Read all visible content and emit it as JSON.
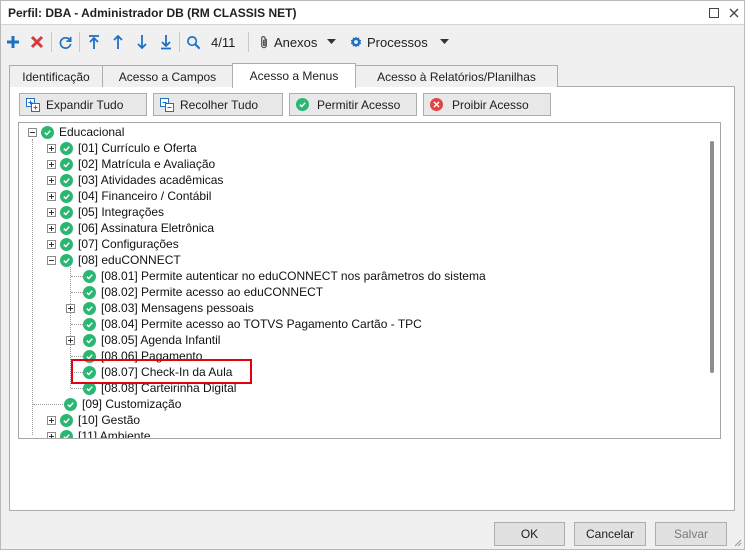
{
  "window": {
    "title": "Perfil: DBA - Administrador DB (RM CLASSIS NET)"
  },
  "toolbar": {
    "record_counter": "4/11",
    "attachments_label": "Anexos",
    "processes_label": "Processos"
  },
  "tabs": [
    {
      "label": "Identificação",
      "active": false
    },
    {
      "label": "Acesso a Campos",
      "active": false
    },
    {
      "label": "Acesso a Menus",
      "active": true
    },
    {
      "label": "Acesso à Relatórios/Planilhas",
      "active": false
    }
  ],
  "actions": {
    "expand_all": "Expandir Tudo",
    "collapse_all": "Recolher Tudo",
    "allow_access": "Permitir Acesso",
    "deny_access": "Proibir Acesso"
  },
  "tree": {
    "root": "Educacional",
    "items": [
      {
        "label": "[01] Currículo e Oferta",
        "expandable": true
      },
      {
        "label": "[02] Matrícula e Avaliação",
        "expandable": true
      },
      {
        "label": "[03] Atividades acadêmicas",
        "expandable": true
      },
      {
        "label": "[04] Financeiro / Contábil",
        "expandable": true
      },
      {
        "label": "[05] Integrações",
        "expandable": true
      },
      {
        "label": "[06] Assinatura Eletrônica",
        "expandable": true
      },
      {
        "label": "[07] Configurações",
        "expandable": true
      },
      {
        "label": "[08] eduCONNECT",
        "expandable": true,
        "expanded": true
      }
    ],
    "children": [
      {
        "label": "[08.01] Permite autenticar no eduCONNECT nos parâmetros do sistema",
        "expandable": false
      },
      {
        "label": "[08.02] Permite acesso ao eduCONNECT",
        "expandable": false
      },
      {
        "label": "[08.03] Mensagens pessoais",
        "expandable": true
      },
      {
        "label": "[08.04] Permite acesso ao TOTVS Pagamento Cartão - TPC",
        "expandable": false
      },
      {
        "label": "[08.05] Agenda Infantil",
        "expandable": true
      },
      {
        "label": "[08.06] Pagamento",
        "expandable": false
      },
      {
        "label": "[08.07] Check-In da Aula",
        "expandable": false,
        "highlighted": true
      },
      {
        "label": "[08.08] Carteirinha Digital",
        "expandable": false
      }
    ],
    "after": [
      {
        "label": "[09] Customização",
        "expandable": false
      },
      {
        "label": "[10] Gestão",
        "expandable": true
      },
      {
        "label": "[11] Ambiente",
        "expandable": true
      }
    ]
  },
  "footer": {
    "ok": "OK",
    "cancel": "Cancelar",
    "save": "Salvar"
  },
  "colors": {
    "check_green": "#2bb673",
    "highlight_red": "#e3000f",
    "add_blue": "#1f6fc2",
    "delete_red": "#d63b3b"
  }
}
